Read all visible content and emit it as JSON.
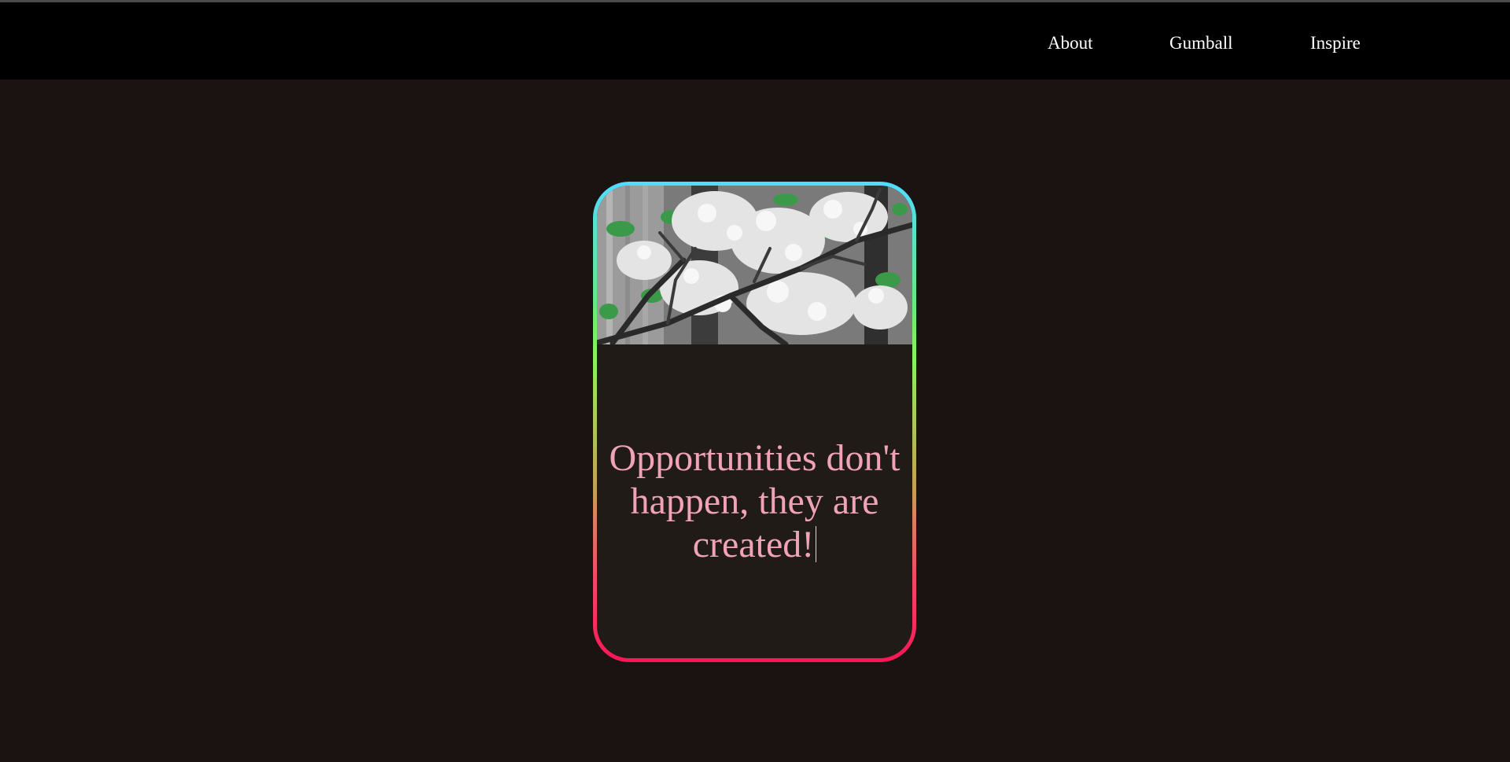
{
  "nav": {
    "items": [
      {
        "label": "About"
      },
      {
        "label": "Gumball"
      },
      {
        "label": "Inspire"
      }
    ]
  },
  "card": {
    "image_icon": "cherry-blossom-photo",
    "quote": "Opportunities don't happen, they are created!"
  },
  "colors": {
    "page_background": "#1b1311",
    "navbar_background": "#000000",
    "card_background": "#201b17",
    "quote_text": "#f1a3b6",
    "border_gradient": [
      "#4fdcff",
      "#63ea80",
      "#8ef05a",
      "#c99a5a",
      "#f34a64",
      "#ff1558"
    ]
  }
}
